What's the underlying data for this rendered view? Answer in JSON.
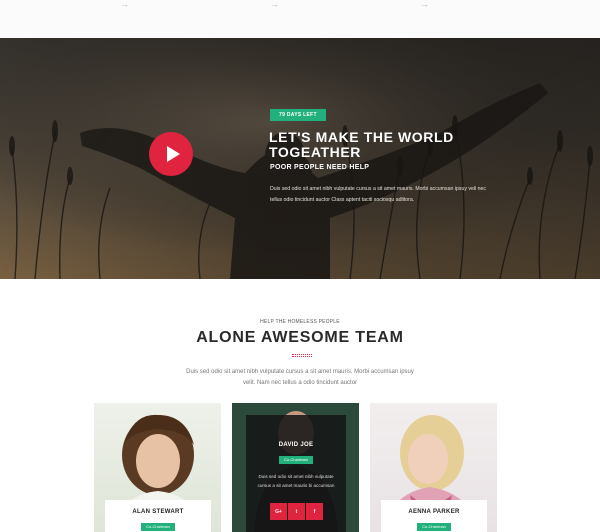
{
  "top_arrows": [
    "→",
    "→",
    "→"
  ],
  "hero": {
    "badge": "79 DAYS LEFT",
    "title": "LET'S MAKE THE WORLD TOGEATHER",
    "subtitle": "POOR PEOPLE NEED HELP",
    "text": "Duis sed odio sit amet nibh vulputate cursus a sit amet mauris. Morbi accumsan ipsuy veli nec tellus odio tincidunt auctor Class aptent taciti sociosqu adlitora."
  },
  "team": {
    "kicker": "HELP THE HOMELESS PEOPLE",
    "title": "ALONE AWESOME TEAM",
    "description": "Duis sed odio sit amet nibh vulputate cursus a sit amet mauris. Morbi accumsan ipsuy velit. Nam nec tellus a odio tincidunt auctor",
    "members": [
      {
        "name": "ALAN STEWART",
        "role": "Co-Chairman"
      },
      {
        "name": "DAVID JOE",
        "role": "Co-Chairman",
        "text": "Duis sed odio sit amet nibh vulputate cursus a sit amet mauris bi accumsan"
      },
      {
        "name": "AENNA PARKER",
        "role": "Co-Chairman"
      }
    ],
    "socials": [
      "G+",
      "t",
      "f"
    ]
  },
  "colors": {
    "accent_red": "#e0233f",
    "accent_green": "#22b07d"
  }
}
